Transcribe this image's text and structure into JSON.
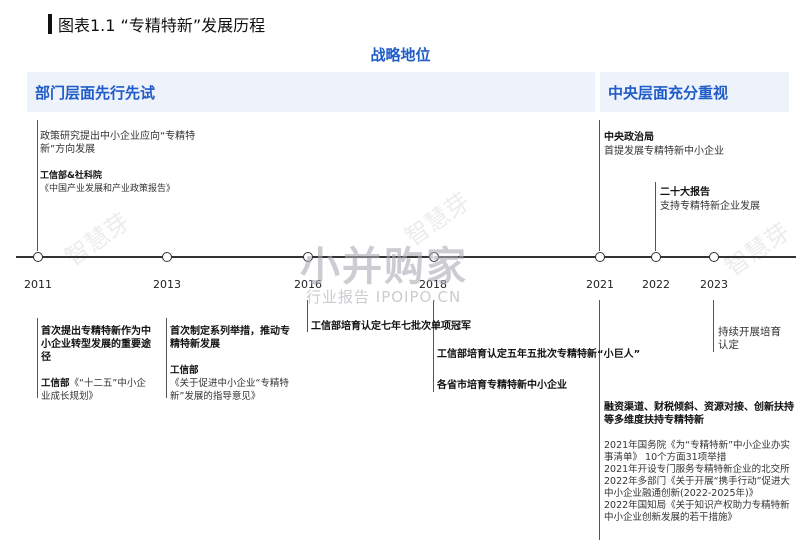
{
  "title": "图表1.1 “专精特新”发展历程",
  "strategy_label": "战略地位",
  "bands": {
    "left": "部门层面先行先试",
    "right": "中央层面充分重视"
  },
  "years": [
    "2011",
    "2013",
    "2016",
    "2018",
    "2021",
    "2022",
    "2023"
  ],
  "upper": {
    "policy_study": "政策研究提出中小企业应向“专精特新”方向发展",
    "miit_cass": "工信部&社科院",
    "miit_cass_report": "《中国产业发展和产业政策报告》",
    "politburo": "中央政治局",
    "politburo_text": "首提发展专精特新中小企业",
    "congress20": "二十大报告",
    "congress20_text": "支持专精特新企业发展"
  },
  "lower": {
    "y2011_title": "首次提出专精特新作为中小企业转型发展的重要途径",
    "y2011_src": "工信部",
    "y2011_doc": "《“十二五”中小企业成长规划》",
    "y2013_title": "首次制定系列举措，推动专精特新发展",
    "y2013_src": "工信部",
    "y2013_doc": "《关于促进中小企业“专精特新”发展的指导意见》",
    "y2016": "工信部培育认定七年七批次单项冠军",
    "y2018_a": "工信部培育认定五年五批次专精特新“小巨人”",
    "y2018_b": "各省市培育专精特新中小企业",
    "y2023": "持续开展培育认定",
    "y2021_title": "融资渠道、财税倾斜、资源对接、创新扶持等多维度扶持专精特新",
    "y2021_items": [
      "2021年国务院《为“专精特新”中小企业办实事清单》 10个方面31项举措",
      "2021年开设专门服务专精特新企业的北交所",
      "2022年多部门《关于开展“携手行动”促进大中小企业融通创新(2022-2025年)》",
      "2022年国知局《关于知识产权助力专精特新中小企业创新发展的若干措施》"
    ]
  },
  "watermark": {
    "main": "小并购家",
    "sub": "行业报告 IPOIPO.CN",
    "diag": "智慧芽"
  }
}
